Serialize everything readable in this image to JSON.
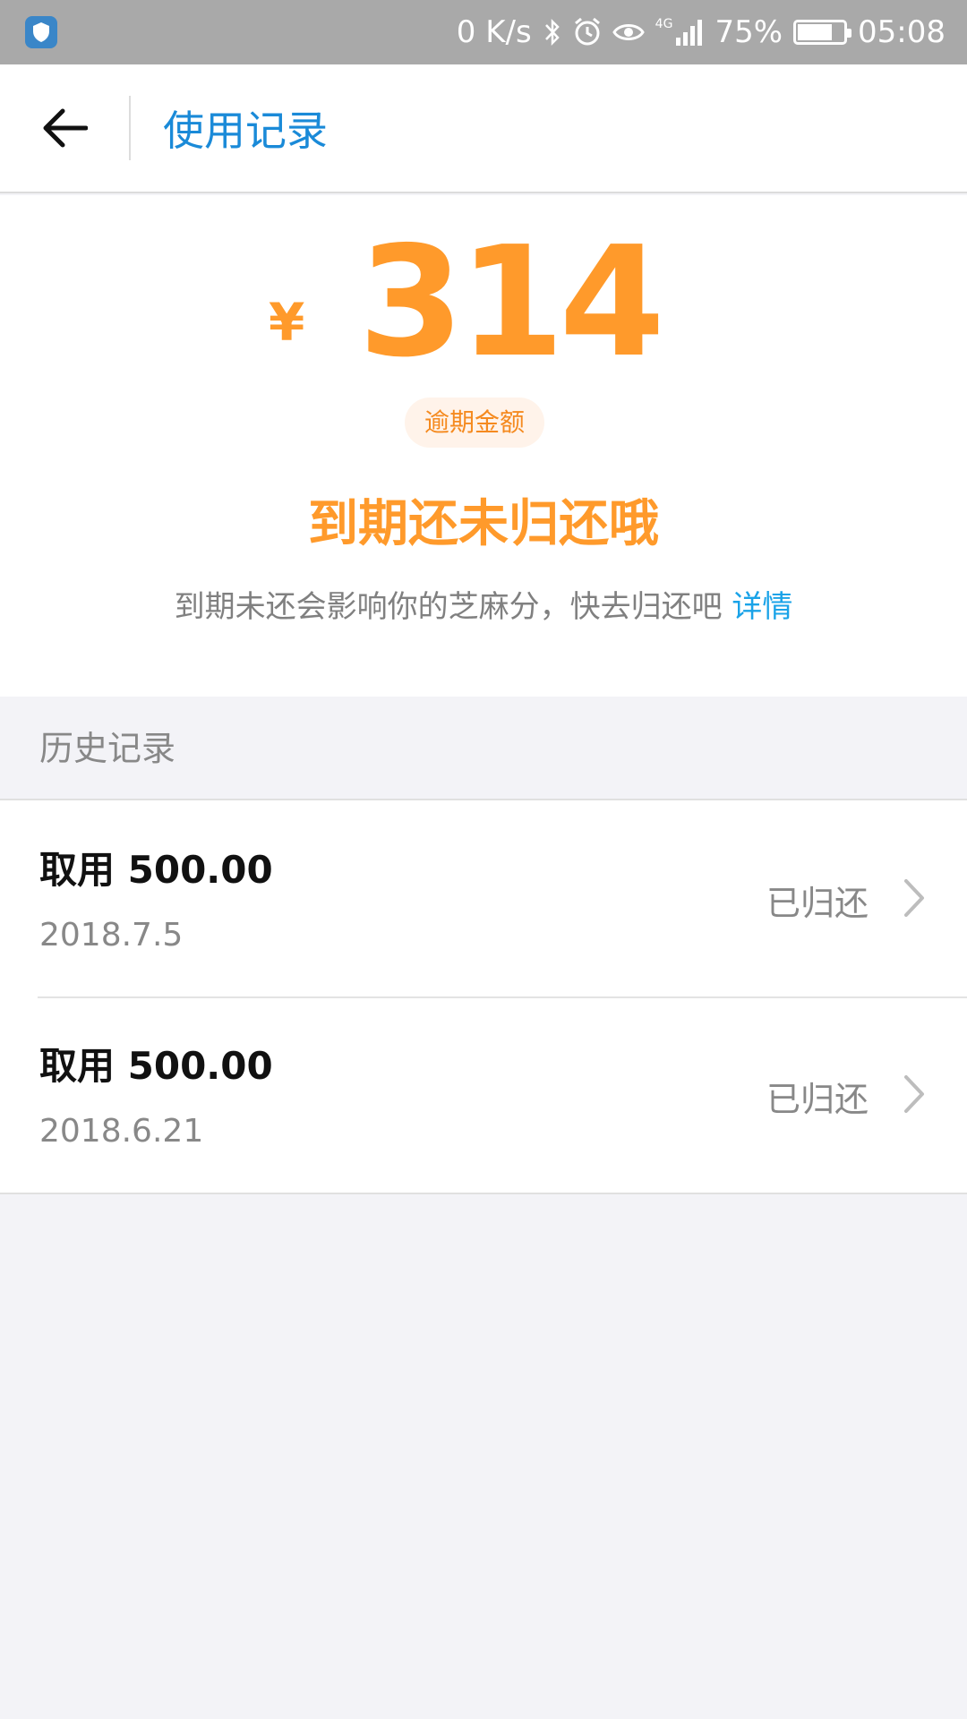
{
  "status_bar": {
    "net_speed": "0 K/s",
    "signal_label": "4G",
    "battery_percent": "75%",
    "battery_level": 0.75,
    "time": "05:08"
  },
  "header": {
    "title": "使用记录"
  },
  "summary": {
    "currency_symbol": "¥",
    "amount": "314",
    "amount_label": "逾期金额",
    "headline": "到期还未归还哦",
    "hint": "到期未还会影响你的芝麻分，快去归还吧 ",
    "hint_link": "详情"
  },
  "history": {
    "section_title": "历史记录",
    "items": [
      {
        "title": "取用 500.00",
        "date": "2018.7.5",
        "status": "已归还"
      },
      {
        "title": "取用 500.00",
        "date": "2018.6.21",
        "status": "已归还"
      }
    ]
  },
  "colors": {
    "accent": "#ff9a2b",
    "link": "#1aa3e8",
    "title": "#1a8ad8"
  }
}
